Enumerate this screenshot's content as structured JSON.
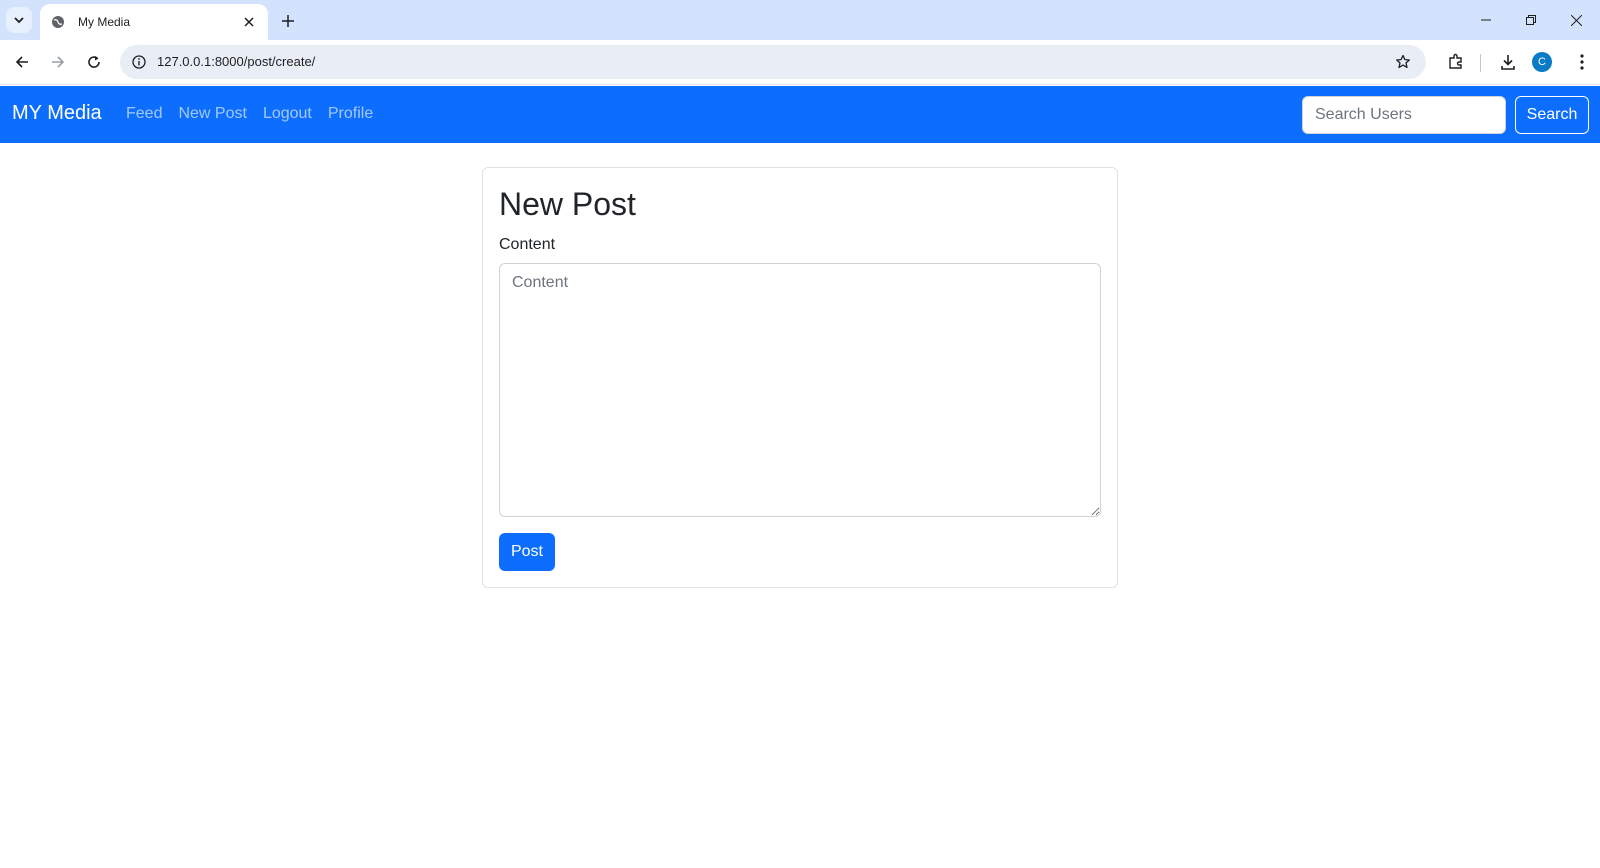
{
  "browser": {
    "tab_title": "My Media",
    "url": "127.0.0.1:8000/post/create/",
    "profile_initial": "C"
  },
  "navbar": {
    "brand": "MY Media",
    "links": [
      "Feed",
      "New Post",
      "Logout",
      "Profile"
    ],
    "search_placeholder": "Search Users",
    "search_button": "Search"
  },
  "form": {
    "title": "New Post",
    "content_label": "Content",
    "content_placeholder": "Content",
    "submit_label": "Post"
  },
  "colors": {
    "primary": "#0d6efd",
    "tabstrip": "#d3e3fd",
    "omnibox": "#e9eef6"
  }
}
